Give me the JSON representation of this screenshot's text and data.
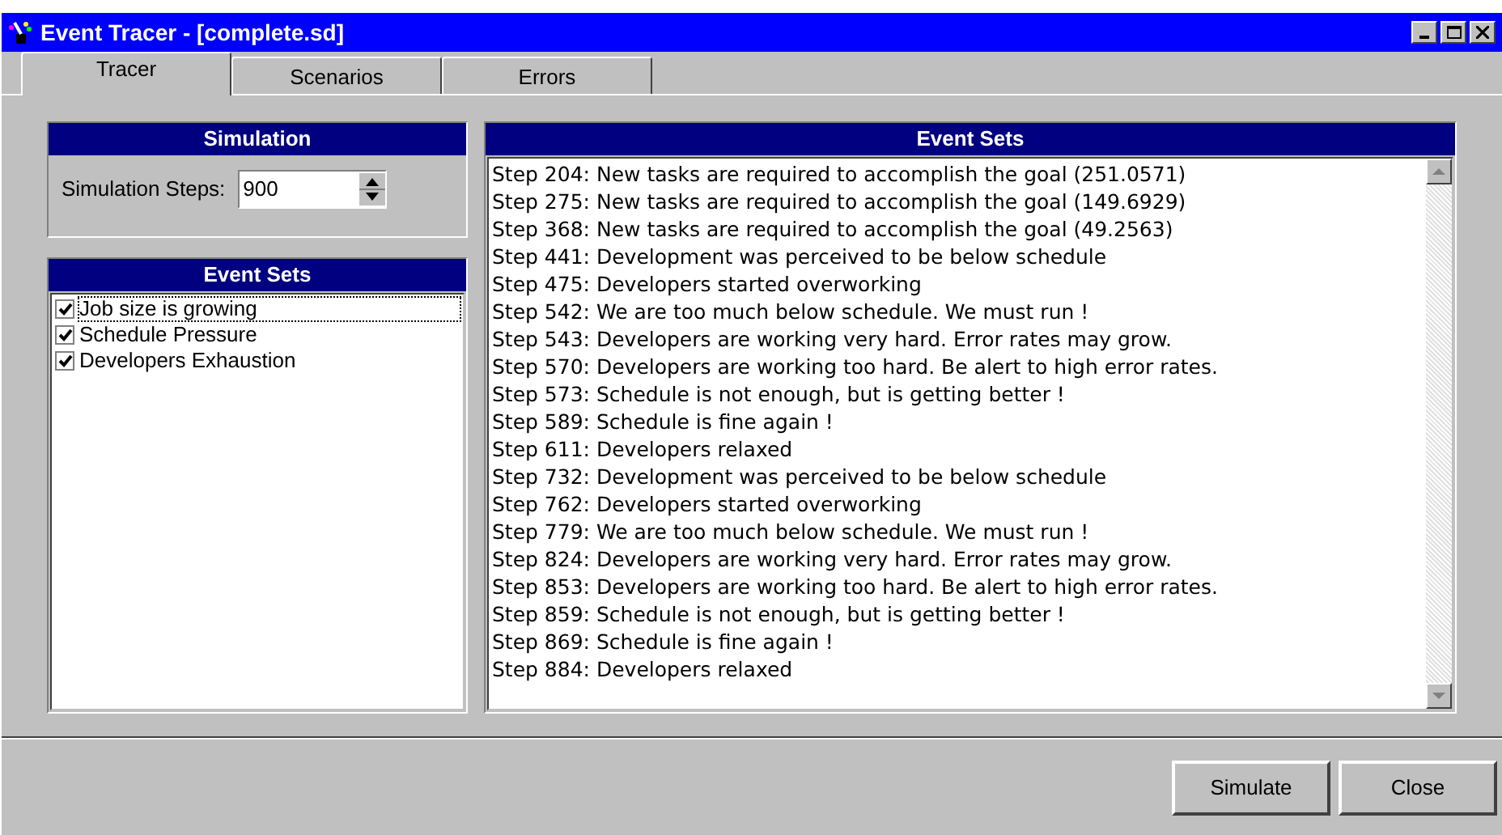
{
  "window": {
    "title": "Event Tracer - [complete.sd]"
  },
  "tabs": [
    {
      "label": "Tracer",
      "selected": true
    },
    {
      "label": "Scenarios",
      "selected": false
    },
    {
      "label": "Errors",
      "selected": false
    }
  ],
  "simulation": {
    "title": "Simulation",
    "steps_label": "Simulation Steps:",
    "steps_value": "900"
  },
  "event_sets": {
    "title": "Event Sets",
    "items": [
      {
        "label": "Job size is growing",
        "checked": true,
        "focused": true
      },
      {
        "label": "Schedule Pressure",
        "checked": true,
        "focused": false
      },
      {
        "label": "Developers Exhaustion",
        "checked": true,
        "focused": false
      }
    ]
  },
  "log": {
    "title": "Event Sets",
    "lines": [
      "Step 204: New tasks are required to accomplish the goal (251.0571)",
      "Step 275: New tasks are required to accomplish the goal (149.6929)",
      "Step 368: New tasks are required to accomplish the goal (49.2563)",
      "Step 441: Development was perceived to be below schedule",
      "Step 475: Developers started overworking",
      "Step 542: We are too much below schedule. We must run !",
      "Step 543: Developers are working very hard. Error rates may grow.",
      "Step 570: Developers are working too hard. Be alert to high error rates.",
      "Step 573: Schedule is not enough, but is getting better !",
      "Step 589: Schedule is fine again !",
      "Step 611: Developers relaxed",
      "Step 732: Development was perceived to be below schedule",
      "Step 762: Developers started overworking",
      "Step 779: We are too much below schedule. We must run !",
      "Step 824: Developers are working very hard. Error rates may grow.",
      "Step 853: Developers are working too hard. Be alert to high error rates.",
      "Step 859: Schedule is not enough, but is getting better !",
      "Step 869: Schedule is fine again !",
      "Step 884: Developers relaxed"
    ]
  },
  "buttons": [
    {
      "label": "Simulate"
    },
    {
      "label": "Close"
    }
  ]
}
